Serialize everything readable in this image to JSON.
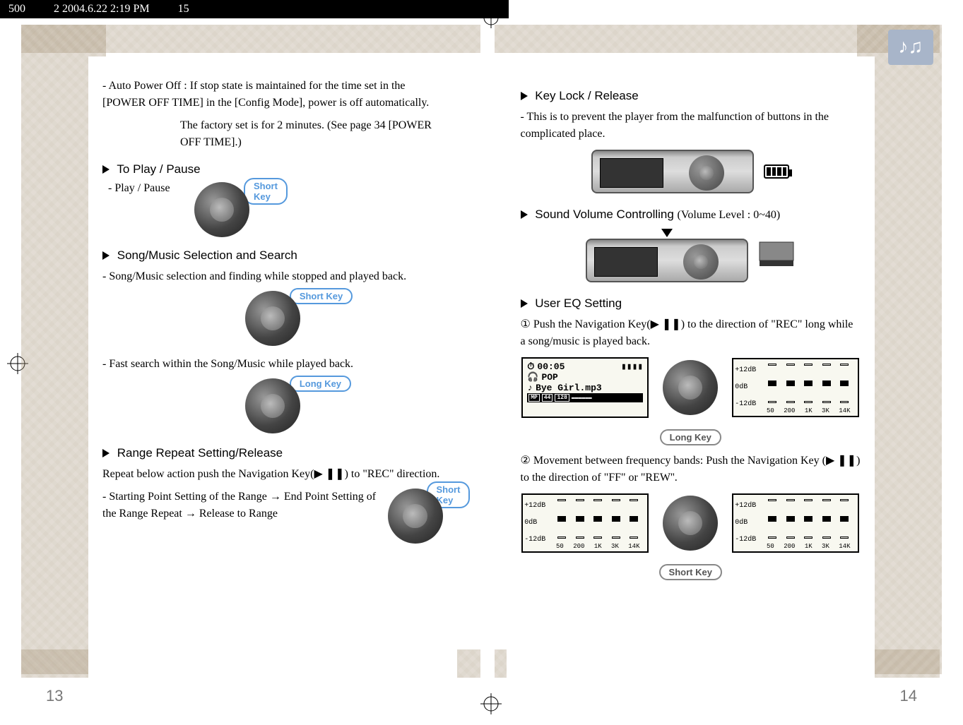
{
  "header": {
    "file": "500",
    "meta": "2  2004.6.22 2:19 PM",
    "page": "15"
  },
  "left_page": {
    "auto_power_off_label": "- Auto Power Off :",
    "auto_power_off_1": "If stop state is maintained for the time set in the [POWER OFF TIME] in the [Config Mode], power is off automatically.",
    "auto_power_off_2": "The factory set is for 2 minutes. (See page 34 [POWER OFF TIME].)",
    "to_play_pause": "To Play / Pause",
    "play_pause_item": "- Play / Pause",
    "short_key": "Short Key",
    "song_selection": "Song/Music Selection and Search",
    "song_selection_item": "- Song/Music selection and finding while stopped and played back.",
    "fast_search": "- Fast search within the Song/Music while played back.",
    "long_key": "Long Key",
    "range_repeat": "Range Repeat Setting/Release",
    "range_repeat_desc": "Repeat below action push the Navigation Key(▶ ❚❚) to \"REC\" direction.",
    "range_steps": "- Starting Point Setting of the Range → End Point Setting of the Range Repeat → Release to Range",
    "page_num": "13"
  },
  "right_page": {
    "key_lock": "Key Lock / Release",
    "key_lock_desc": "- This is to prevent the player from the malfunction of buttons in the complicated place.",
    "sound_volume": "Sound Volume Controlling",
    "volume_level": "(Volume Level : 0~40)",
    "user_eq": "User EQ Setting",
    "step1_num": "①",
    "step1": "Push the Navigation Key(▶ ❚❚) to the direction of \"REC\" long while a song/music is played back.",
    "lcd_time": "00:05",
    "lcd_mode": "POP",
    "lcd_file": "Bye Girl.mp3",
    "lcd_meta_mp": "MP",
    "lcd_meta_44": "44",
    "lcd_meta_128": "128",
    "long_key": "Long Key",
    "step2_num": "②",
    "step2": "Movement between frequency bands: Push the Navigation Key (▶ ❚❚) to the direction of \"FF\" or \"REW''.",
    "short_key": "Short Key",
    "eq_y_top": "+12dB",
    "eq_y_mid": "0dB",
    "eq_y_bot": "-12dB",
    "eq_x_50": "50",
    "eq_x_200": "200",
    "eq_x_1k": "1K",
    "eq_x_3k": "3K",
    "eq_x_14k": "14K",
    "page_num": "14"
  }
}
